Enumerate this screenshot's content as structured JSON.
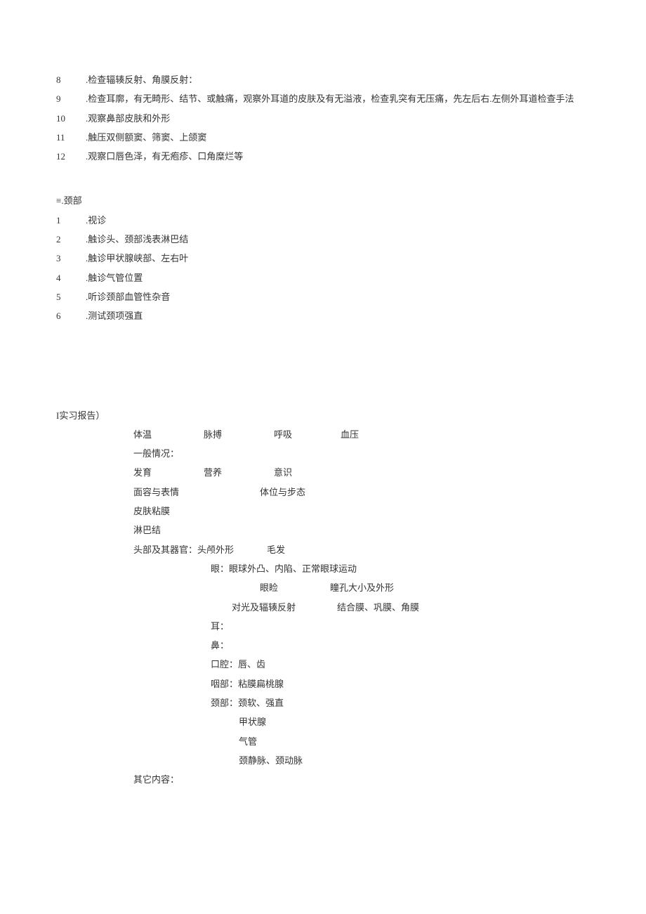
{
  "listA": [
    {
      "num": "8",
      "text": ".检查辐辏反射、角膜反射："
    },
    {
      "num": "9",
      "text": ".检查耳廓，有无畸形、结节、或触痛，观察外耳道的皮肤及有无溢液，检查乳突有无压痛，先左后右.左侧外耳道检查手法"
    },
    {
      "num": "10",
      "text": ".观察鼻部皮肤和外形"
    },
    {
      "num": "11",
      "text": ".触压双侧额窦、筛窦、上颌窦"
    },
    {
      "num": "12",
      "text": ".观察口唇色泽，有无疱疹、口角糜烂等"
    }
  ],
  "sectionB": {
    "heading": "≡.颈部",
    "items": [
      {
        "num": "1",
        "text": ".视诊"
      },
      {
        "num": "2",
        "text": ".触诊头、颈部浅表淋巴结"
      },
      {
        "num": "3",
        "text": ".触诊甲状腺峡部、左右叶"
      },
      {
        "num": "4",
        "text": ".触诊气管位置"
      },
      {
        "num": "5",
        "text": ".听诊颈部血管性杂音"
      },
      {
        "num": "6",
        "text": ".测试颈项强直"
      }
    ]
  },
  "report": {
    "heading": "I实习报告）",
    "vitals": {
      "a": "体温",
      "b": "脉搏",
      "c": "呼吸",
      "d": "血压"
    },
    "general_label": "一般情况：",
    "growth": {
      "a": "发育",
      "b": "营养",
      "c": "意识"
    },
    "face": {
      "a": "面容与表情",
      "b": "体位与步态"
    },
    "skin": "皮肤粘膜",
    "lymph": "淋巴结",
    "head": {
      "a": "头部及其器官：头颅外形",
      "b": "毛发"
    },
    "eye1": "眼：眼球外凸、内陷、正常眼球运动",
    "eye2": {
      "a": "眼睑",
      "b": "瞳孔大小及外形"
    },
    "eye3": {
      "a": "对光及辐辏反射",
      "b": "结合膜、巩膜、角膜"
    },
    "ear": "耳：",
    "nose": "鼻：",
    "mouth": "口腔：唇、齿",
    "throat": "咽部：粘膜扁桃腺",
    "neck": "颈部：颈软、强直",
    "neck_sub": [
      "甲状腺",
      "气管",
      "颈静脉、颈动脉"
    ],
    "other": "其它内容："
  }
}
